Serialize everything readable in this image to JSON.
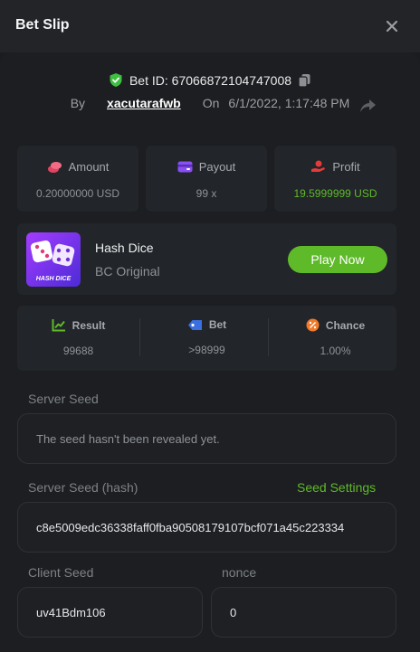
{
  "header": {
    "title": "Bet Slip"
  },
  "bet": {
    "id_text": "Bet ID: 67066872104747008",
    "by_label": "By",
    "username": "xacutarafwb",
    "on_label": "On",
    "datetime": "6/1/2022, 1:17:48 PM"
  },
  "stats": {
    "amount": {
      "label": "Amount",
      "value": "0.20000000 USD"
    },
    "payout": {
      "label": "Payout",
      "value": "99 x"
    },
    "profit": {
      "label": "Profit",
      "value": "19.5999999 USD"
    }
  },
  "game": {
    "name": "Hash Dice",
    "subtitle": "BC Original",
    "thumb_text": "HASH DICE",
    "play_label": "Play Now"
  },
  "result": {
    "result": {
      "label": "Result",
      "value": "99688"
    },
    "bet": {
      "label": "Bet",
      "value": ">98999"
    },
    "chance": {
      "label": "Chance",
      "value": "1.00%"
    }
  },
  "seeds": {
    "server_seed_label": "Server Seed",
    "server_seed_value": "The seed hasn't been revealed yet.",
    "server_hash_label": "Server Seed (hash)",
    "seed_settings_label": "Seed Settings",
    "server_hash_value": "c8e5009edc36338faff0fba90508179107bcf071a45c223334",
    "client_seed_label": "Client Seed",
    "client_seed_value": "uv41Bdm106",
    "nonce_label": "nonce",
    "nonce_value": "0"
  },
  "colors": {
    "accent": "#5fba2a",
    "profit": "#5fba2a"
  }
}
